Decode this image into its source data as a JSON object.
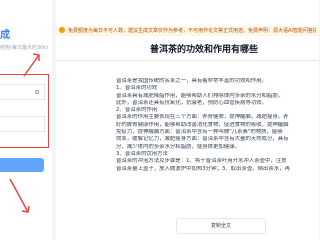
{
  "left": {
    "title": "成",
    "subtitle": "结构(每次最大约30k)"
  },
  "notice": {
    "text": "免费额度为每日不可人数，建议生成文章仅作为参考，不可用作论文等正式用途。免费声明：源大语AI智能问答提供服务"
  },
  "document": {
    "title": "普洱茶的功效和作用有哪些",
    "lines": [
      "普洱茶是我国传统的名茶之一，具有着非常丰富的功效和作用。",
      "1、普洱茶的功效",
      "普洱茶具有减肥降脂作用，能够帮助人们排除体内多余的水分和脂肪，",
      "此外，普洱茶还具有抗氧化，抗衰老，预防心血管疾病等功效。",
      "2、普洱茶的作用",
      "普洱茶的作用主要表现在三个方面：养胃健脾，提神醒脑，减肥瘦身。养",
      "好的脾胃健康作用，能够帮助改善消化食物，促进食物的吸收，提神醒脑",
      "免疫力，提神醒脑方面：普洱茶中含有一种叫做\"儿茶素\"的物质，能够",
      "效率，缓解记忆力，减肥瘦身方面：普洱茶中含有大量的天然成分，具有",
      "分，减少体内的多余水分和脂肪，使身体更加健康。",
      "3、普洱茶的饮用方法",
      "普洱茶的冲泡方法及步骤是：1、将干普洱茶叶用开水冲入茶壶中，注意",
      "普洱茶量上盖子，放入微波炉中加热3分钟；3、取出茶壶，倒出茶水，再"
    ],
    "copy_label": "复制全文"
  }
}
